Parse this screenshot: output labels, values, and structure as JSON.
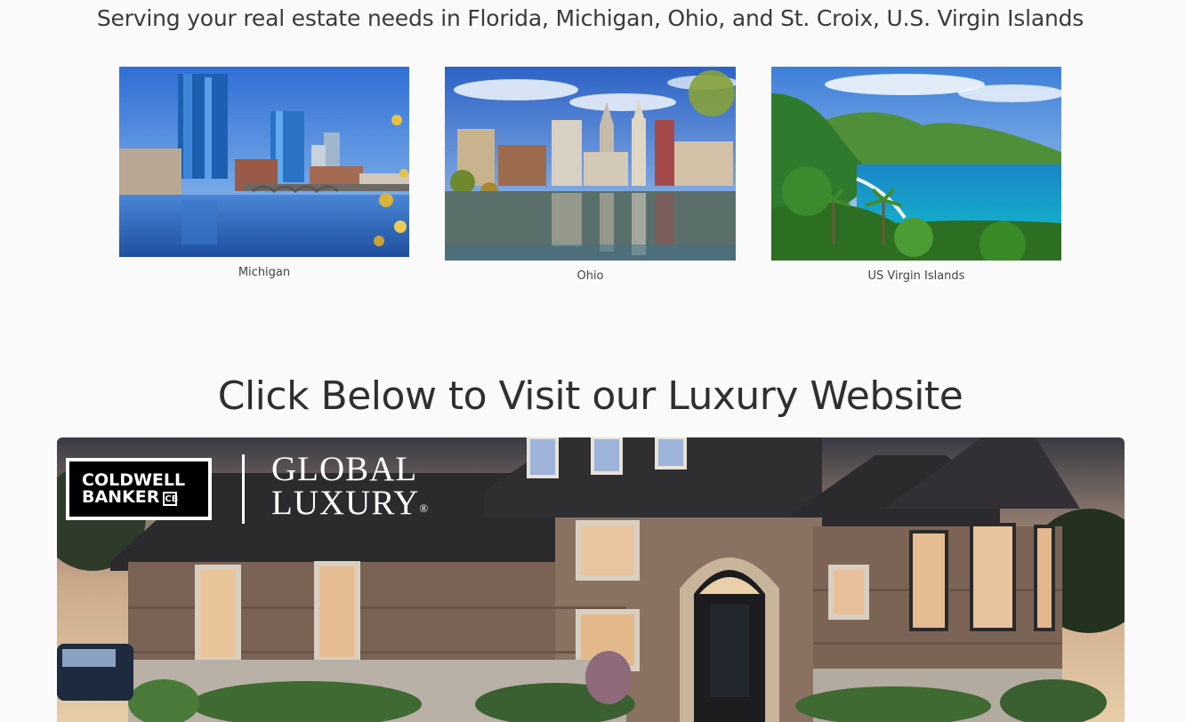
{
  "header": {
    "tagline": "Serving your real estate needs in Florida, Michigan, Ohio, and St. Croix, U.S. Virgin Islands"
  },
  "regions": [
    {
      "caption": "Michigan"
    },
    {
      "caption": "Ohio"
    },
    {
      "caption": "US Virgin Islands"
    }
  ],
  "luxury": {
    "heading": "Click Below to Visit our Luxury Website",
    "brand_line1": "COLDWELL",
    "brand_line2": "BANKER",
    "brand_mark": "CB",
    "global_line1": "GLOBAL",
    "global_line2": "LUXURY",
    "registered": "®"
  },
  "colors": {
    "sky_blue": "#3d7fd8",
    "water_blue": "#2a64b8",
    "sea_turquoise": "#12a6c9",
    "jungle_green": "#2f7a2c",
    "stone_brown": "#7a6355",
    "roof_dark": "#2b2a2c"
  }
}
